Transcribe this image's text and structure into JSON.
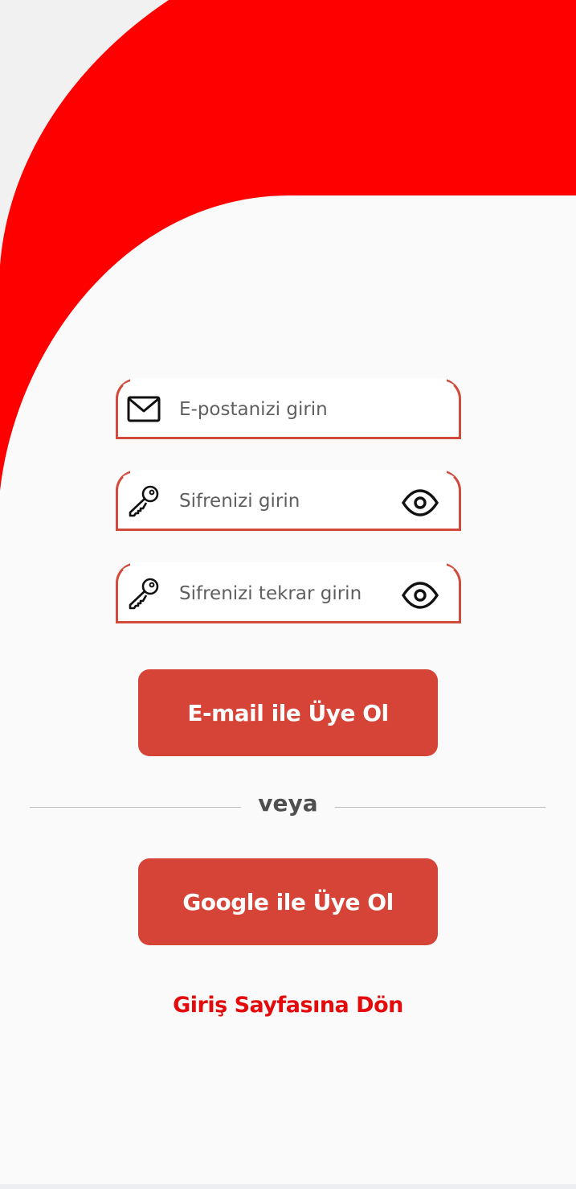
{
  "colors": {
    "brand_red": "#ff0000",
    "accent_red": "#d64337",
    "field_border": "#d24a3c",
    "link_red": "#e30b0b",
    "background": "#fafafa"
  },
  "form": {
    "email": {
      "icon": "mail-icon",
      "placeholder": "E-postanizi girin",
      "value": ""
    },
    "password": {
      "icon": "key-icon",
      "placeholder": "Sifrenizi girin",
      "value": "",
      "toggle_icon": "eye-icon"
    },
    "password_confirm": {
      "icon": "key-icon",
      "placeholder": "Sifrenizi tekrar girin",
      "value": "",
      "toggle_icon": "eye-icon"
    }
  },
  "buttons": {
    "email_signup": "E-mail ile Üye Ol",
    "google_signup": "Google ile Üye Ol"
  },
  "divider": {
    "label": "veya"
  },
  "links": {
    "back_to_login": "Giriş Sayfasına Dön"
  }
}
